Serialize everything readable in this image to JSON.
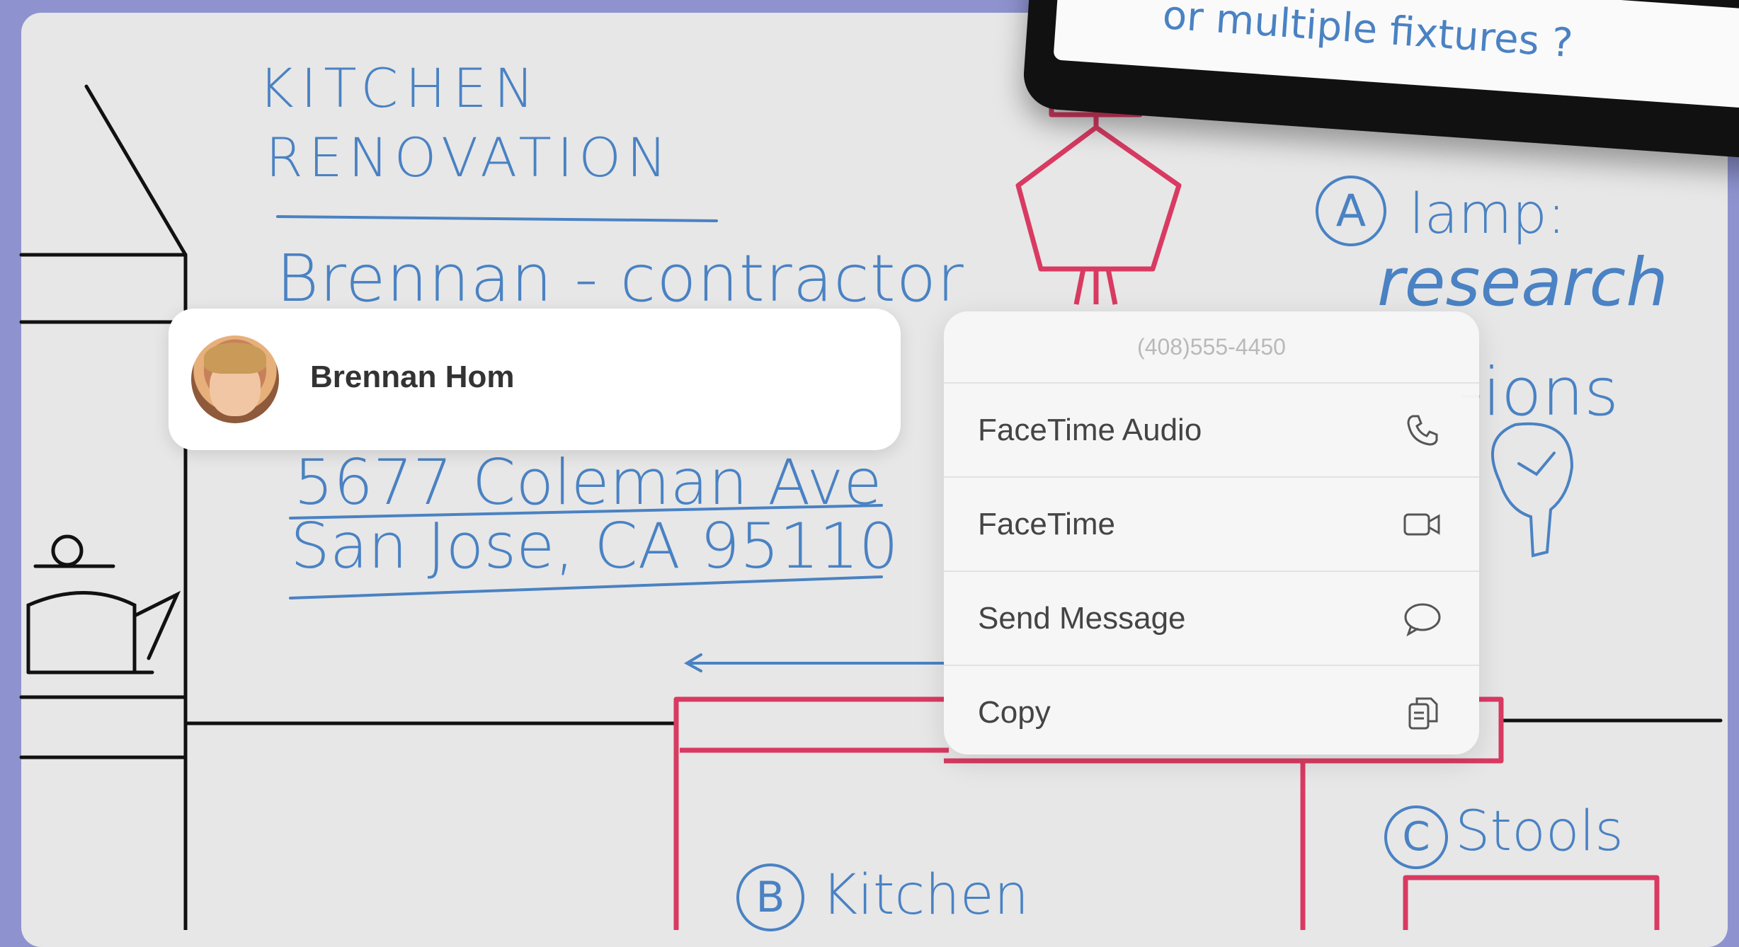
{
  "note": {
    "text": "or multiple fixtures ?"
  },
  "sketch": {
    "title_line1": "KITCHEN",
    "title_line2": "RENOVATION",
    "contractor": "Brennan - contractor",
    "address_line1": "5677 Coleman Ave",
    "address_line2": "San Jose, CA 95110",
    "lamp_letter": "A",
    "lamp_label": "lamp:",
    "research_label": "research",
    "options_fragment": "-ions",
    "kitchen_letter": "B",
    "kitchen_label": "Kitchen",
    "stools_letter": "C",
    "stools_label": "Stools"
  },
  "contact": {
    "name": "Brennan Hom",
    "avatar_icon": "person-photo"
  },
  "menu": {
    "phone": "(408)555-4450",
    "items": [
      {
        "label": "FaceTime Audio",
        "icon": "phone-icon"
      },
      {
        "label": "FaceTime",
        "icon": "video-camera-icon"
      },
      {
        "label": "Send Message",
        "icon": "message-bubble-icon"
      },
      {
        "label": "Copy",
        "icon": "copy-icon"
      }
    ]
  },
  "colors": {
    "ink_blue": "#4a82c3",
    "ink_red": "#d93a62",
    "ink_black": "#111111",
    "background": "#8e93cf"
  }
}
